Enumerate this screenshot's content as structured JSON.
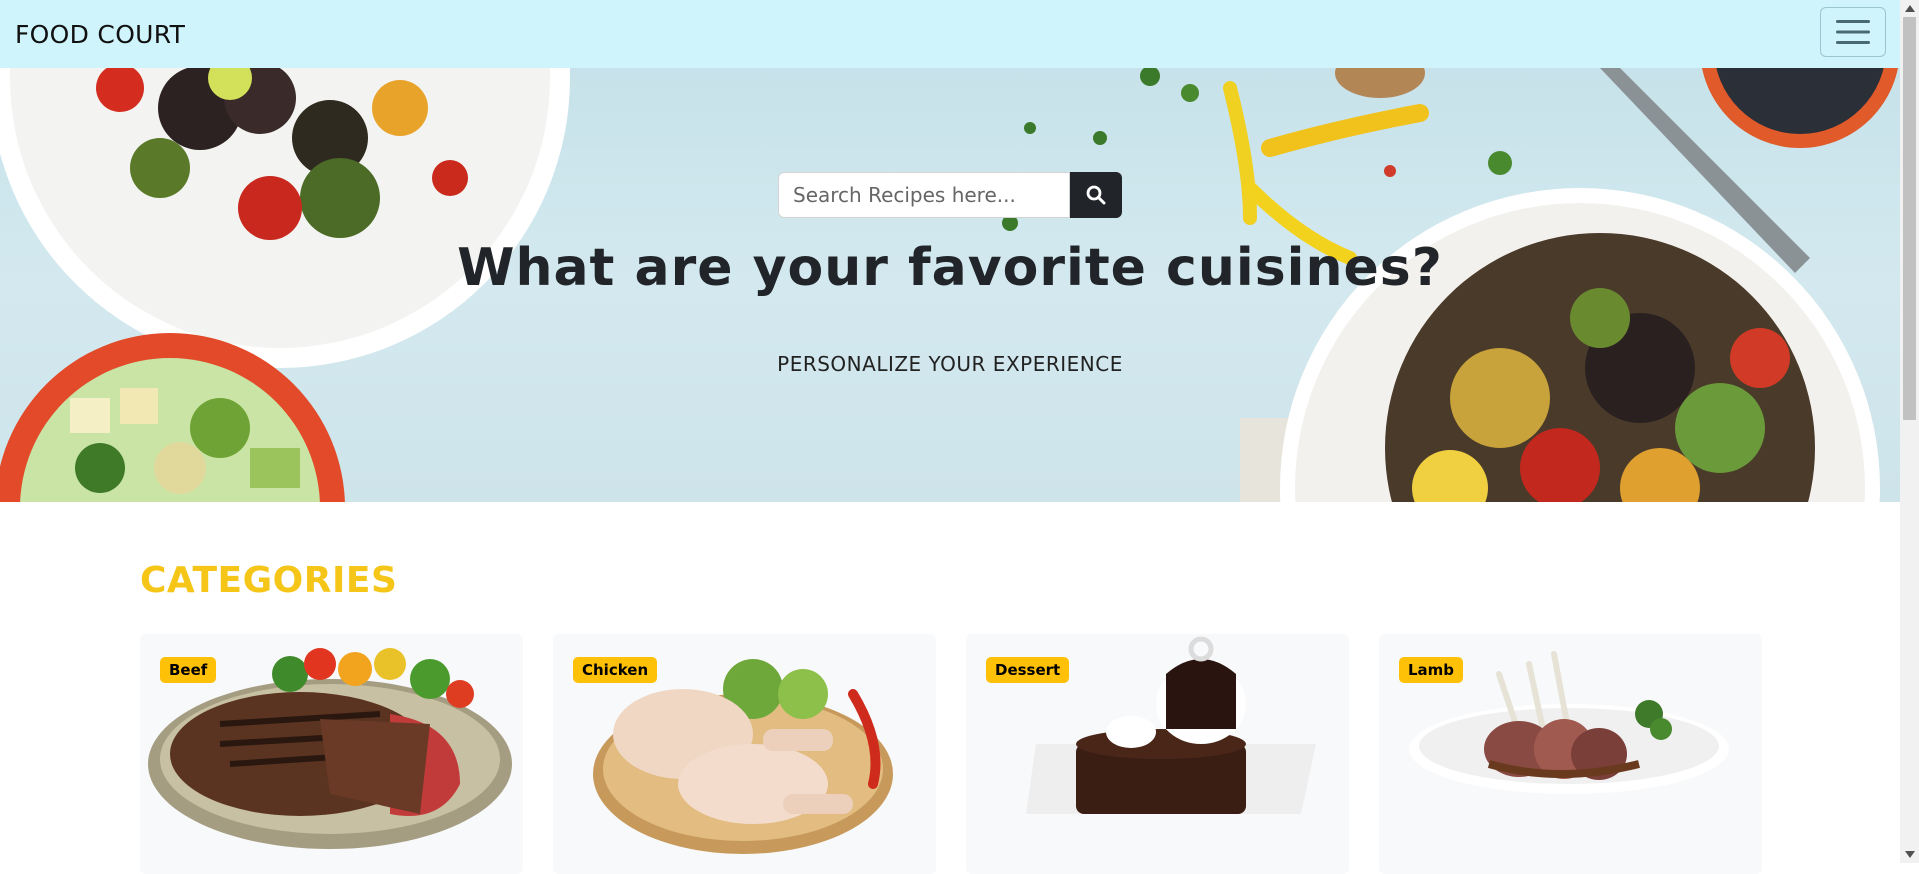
{
  "navbar": {
    "brand": "FOOD COURT",
    "toggler_icon": "hamburger-menu-icon",
    "background": "#cff4fc"
  },
  "hero": {
    "search": {
      "placeholder": "Search Recipes here...",
      "value": "",
      "button_icon": "search-icon"
    },
    "title": "What are your favorite cuisines?",
    "subtitle": "PERSONALIZE YOUR EXPERIENCE"
  },
  "categories": {
    "title": "CATEGORIES",
    "accent": "#f5c518",
    "items": [
      {
        "label": "Beef",
        "image": "grilled-steak-image"
      },
      {
        "label": "Chicken",
        "image": "raw-chicken-legs-image"
      },
      {
        "label": "Dessert",
        "image": "chocolate-cake-image"
      },
      {
        "label": "Lamb",
        "image": "lamb-chops-image"
      }
    ]
  },
  "colors": {
    "badge": "#ffc107",
    "search_button": "#212529",
    "card_bg": "#f8f9fa"
  }
}
